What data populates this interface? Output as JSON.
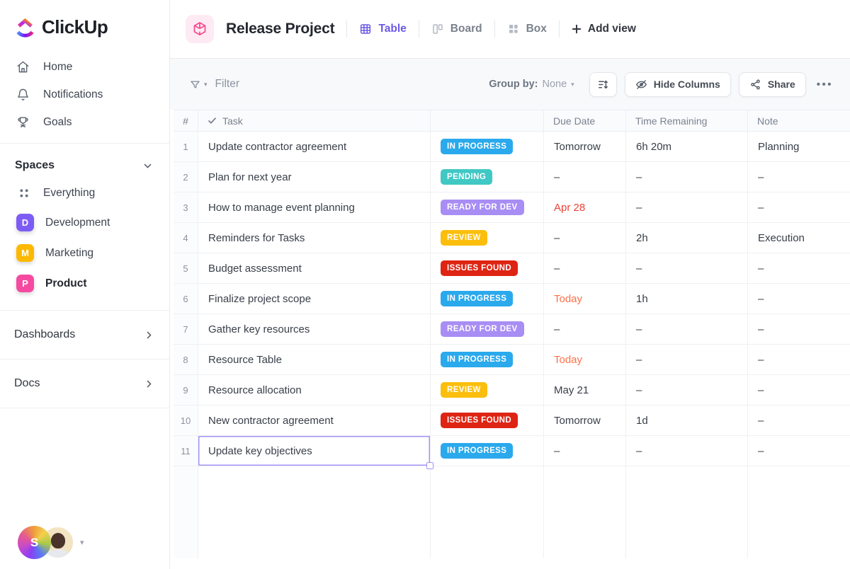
{
  "brand": {
    "name": "ClickUp",
    "accent": "#6b5ae8"
  },
  "sidebar": {
    "nav": [
      {
        "label": "Home"
      },
      {
        "label": "Notifications"
      },
      {
        "label": "Goals"
      }
    ],
    "spaces_header": "Spaces",
    "everything_label": "Everything",
    "spaces": [
      {
        "label": "Development",
        "badge": "D",
        "color": "#7d5cf5"
      },
      {
        "label": "Marketing",
        "badge": "M",
        "color": "#fdb900"
      },
      {
        "label": "Product",
        "badge": "P",
        "color": "#f64aa1"
      }
    ],
    "links": [
      {
        "label": "Dashboards"
      },
      {
        "label": "Docs"
      }
    ],
    "avatar_initial": "S"
  },
  "header": {
    "title": "Release Project",
    "views": [
      {
        "label": "Table",
        "active": true
      },
      {
        "label": "Board",
        "active": false
      },
      {
        "label": "Box",
        "active": false
      }
    ],
    "add_view": "Add view"
  },
  "toolbar": {
    "filter": "Filter",
    "group_by_label": "Group by:",
    "group_by_value": "None",
    "hide_columns": "Hide Columns",
    "share": "Share",
    "more": "•••"
  },
  "table": {
    "columns": {
      "num": "#",
      "task": "Task",
      "due": "Due Date",
      "time": "Time Remaining",
      "note": "Note"
    },
    "status_colors": {
      "IN PROGRESS": "#2aa9ec",
      "PENDING": "#40c8c4",
      "READY FOR DEV": "#a88df4",
      "REVIEW": "#fbbe0d",
      "ISSUES FOUND": "#de2413"
    },
    "due_colors": {
      "overdue": "#ee4136",
      "today": "#fd7149"
    },
    "rows": [
      {
        "num": "1",
        "task": "Update contractor agreement",
        "status": "IN PROGRESS",
        "due": "Tomorrow",
        "due_kind": "normal",
        "time": "6h 20m",
        "note": "Planning",
        "selected": false
      },
      {
        "num": "2",
        "task": "Plan for next year",
        "status": "PENDING",
        "due": "–",
        "due_kind": "normal",
        "time": "–",
        "note": "–",
        "selected": false
      },
      {
        "num": "3",
        "task": "How to manage event planning",
        "status": "READY FOR DEV",
        "due": "Apr 28",
        "due_kind": "overdue",
        "time": "–",
        "note": "–",
        "selected": false
      },
      {
        "num": "4",
        "task": "Reminders for Tasks",
        "status": "REVIEW",
        "due": "–",
        "due_kind": "normal",
        "time": "2h",
        "note": "Execution",
        "selected": false
      },
      {
        "num": "5",
        "task": "Budget assessment",
        "status": "ISSUES FOUND",
        "due": "–",
        "due_kind": "normal",
        "time": "–",
        "note": "–",
        "selected": false
      },
      {
        "num": "6",
        "task": "Finalize project scope",
        "status": "IN PROGRESS",
        "due": "Today",
        "due_kind": "today",
        "time": "1h",
        "note": "–",
        "selected": false
      },
      {
        "num": "7",
        "task": "Gather key resources",
        "status": "READY FOR DEV",
        "due": "–",
        "due_kind": "normal",
        "time": "–",
        "note": "–",
        "selected": false
      },
      {
        "num": "8",
        "task": "Resource Table",
        "status": "IN PROGRESS",
        "due": "Today",
        "due_kind": "today",
        "time": "–",
        "note": "–",
        "selected": false
      },
      {
        "num": "9",
        "task": "Resource allocation",
        "status": "REVIEW",
        "due": "May 21",
        "due_kind": "normal",
        "time": "–",
        "note": "–",
        "selected": false
      },
      {
        "num": "10",
        "task": "New contractor agreement",
        "status": "ISSUES FOUND",
        "due": "Tomorrow",
        "due_kind": "normal",
        "time": "1d",
        "note": "–",
        "selected": false
      },
      {
        "num": "11",
        "task": "Update key objectives",
        "status": "IN PROGRESS",
        "due": "–",
        "due_kind": "normal",
        "time": "–",
        "note": "–",
        "selected": true
      }
    ]
  }
}
